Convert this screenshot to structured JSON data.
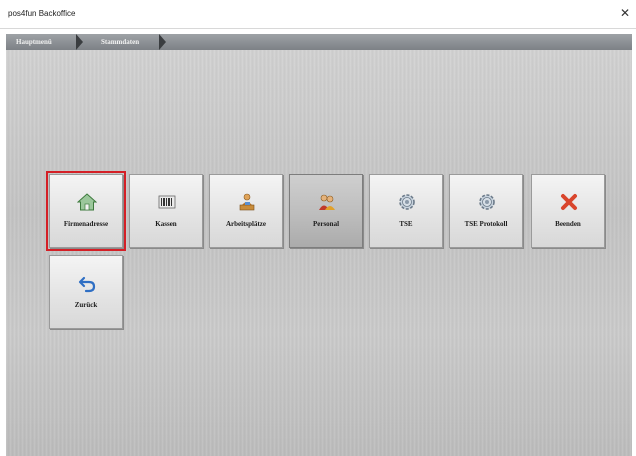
{
  "window": {
    "title": "pos4fun Backoffice",
    "close_glyph": "✕"
  },
  "breadcrumb": {
    "items": [
      "Hauptmenü",
      "Stammdaten"
    ]
  },
  "tiles": [
    {
      "label": "Firmenadresse",
      "icon": "house-icon",
      "selected": true
    },
    {
      "label": "Kassen",
      "icon": "barcode-icon"
    },
    {
      "label": "Arbeitsplätze",
      "icon": "workstation-icon"
    },
    {
      "label": "Personal",
      "icon": "people-icon",
      "active": true
    },
    {
      "label": "TSE",
      "icon": "gear-icon"
    },
    {
      "label": "TSE Protokoll",
      "icon": "gear-icon"
    },
    {
      "label": "Beenden",
      "icon": "close-x-icon"
    },
    {
      "label": "Zurück",
      "icon": "back-arrow-icon"
    }
  ],
  "colors": {
    "selection_border": "#d41f26",
    "breadcrumb_bar": "#8a8e92"
  }
}
